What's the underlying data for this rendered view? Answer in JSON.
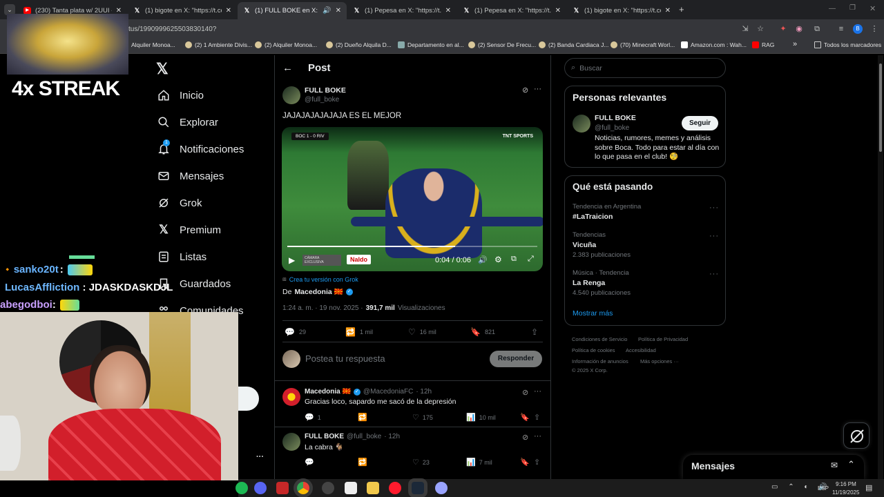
{
  "browser": {
    "tabs": [
      {
        "label": "(230) Tanta plata w/ 2UUI - You",
        "favicon": "youtube-icon",
        "active": false
      },
      {
        "label": "(1) bigote en X: \"https://t.co/or",
        "favicon": "x-icon",
        "active": false
      },
      {
        "label": "(1) FULL BOKE en X: \"JAJAJ",
        "favicon": "x-icon",
        "active": true
      },
      {
        "label": "(1) Pepesa en X: \"https://t.co/hz",
        "favicon": "x-icon",
        "active": false
      },
      {
        "label": "(1) Pepesa en X: \"https://t.co/jih",
        "favicon": "x-icon",
        "active": false
      },
      {
        "label": "(1) bigote en X: \"https://t.co/Qz",
        "favicon": "x-icon",
        "active": false
      }
    ],
    "url": "tus/1990999625503830140?",
    "bookmarks": [
      "Alquiler Monoa...",
      "(2) 1 Ambiente Divis...",
      "(2) Alquiler Monoa...",
      "(2) Dueño Alquila D...",
      "Departamento en al...",
      "(2) Sensor De Frecu...",
      "(2) Banda Cardiaca J...",
      "(70) Minecraft Worl...",
      "Amazon.com : Wah...",
      "RAG"
    ],
    "bookmarks_more": "»",
    "all_bookmarks": "Todos los marcadores"
  },
  "overlay": {
    "streak": "4x STREAK",
    "chat": [
      {
        "user": "sanko20t",
        "sep": " :",
        "msg": ""
      },
      {
        "user": "LucasAffliction",
        "sep": " :",
        "msg": "JDASKDASKDJL"
      },
      {
        "user": "abegodboi",
        "sep": " :",
        "msg": ""
      }
    ]
  },
  "nav": {
    "items": [
      {
        "label": "Inicio",
        "icon": "home-icon"
      },
      {
        "label": "Explorar",
        "icon": "search-icon"
      },
      {
        "label": "Notificaciones",
        "icon": "bell-icon",
        "badge": "1"
      },
      {
        "label": "Mensajes",
        "icon": "mail-icon"
      },
      {
        "label": "Grok",
        "icon": "grok-icon"
      },
      {
        "label": "Premium",
        "icon": "x-icon"
      },
      {
        "label": "Listas",
        "icon": "list-icon"
      },
      {
        "label": "Guardados",
        "icon": "bookmark-icon"
      },
      {
        "label": "Comunidades",
        "icon": "people-icon"
      }
    ],
    "more": "···"
  },
  "post": {
    "header": "Post",
    "author_name": "FULL BOKE",
    "author_handle": "@full_boke",
    "text": "JAJAJAJAJAJAJA ES EL MEJOR",
    "video": {
      "time": "0:04 / 0:06",
      "progress": 0.67,
      "scoreboard": "BOC 1 - 0 RIV",
      "broadcaster": "TNT SPORTS",
      "badge_left": "CÁMARA EXCLUSIVA",
      "badge_right": "Naldo"
    },
    "grok_link": "Crea tu versión con Grok",
    "from_prefix": "De",
    "from_account": "Macedonia 🇲🇰",
    "meta_time": "1:24 a. m. · 19 nov. 2025 ·",
    "views": "391,7 mil",
    "views_label": "Visualizaciones",
    "stats": {
      "replies": "29",
      "reposts": "1 mil",
      "likes": "16 mil",
      "bookmarks": "821"
    },
    "reply_placeholder": "Postea tu respuesta",
    "reply_button": "Responder"
  },
  "replies": [
    {
      "name": "Macedonia 🇲🇰",
      "handle": "@MacedoniaFC",
      "time": "· 12h",
      "text": "Gracias loco, sapardo me sacó de la depresión",
      "replies": "1",
      "likes": "175",
      "views": "10 mil"
    },
    {
      "name": "FULL BOKE",
      "handle": "@full_boke",
      "time": "· 12h",
      "text": "La cabra 🐐",
      "replies": "",
      "likes": "23",
      "views": "7 mil"
    }
  ],
  "right": {
    "search_placeholder": "Buscar",
    "relevant_title": "Personas relevantes",
    "relevant_name": "FULL BOKE",
    "relevant_handle": "@full_boke",
    "relevant_follow": "Seguir",
    "relevant_bio": "Noticias, rumores, memes y análisis sobre Boca. Todo para estar al día con lo que pasa en el club! 🧐",
    "trends_title": "Qué está pasando",
    "trends": [
      {
        "category": "Tendencia en Argentina",
        "name": "#LaTraicion",
        "count": ""
      },
      {
        "category": "Tendencias",
        "name": "Vicuña",
        "count": "2.383 publicaciones"
      },
      {
        "category": "Música · Tendencia",
        "name": "La Renga",
        "count": "4.540 publicaciones"
      }
    ],
    "show_more": "Mostrar más",
    "footer": [
      "Condiciones de Servicio",
      "Política de Privacidad",
      "Política de cookies",
      "Accesibilidad",
      "Información de anuncios",
      "Más opciones ···",
      "© 2025 X Corp."
    ],
    "messages_title": "Mensajes"
  },
  "taskbar": {
    "lang": "ESP",
    "time": "9:16 PM",
    "date": "11/19/2025"
  },
  "colors": {
    "accent": "#1d9bf0",
    "background": "#000000",
    "border": "#2f3336",
    "muted": "#71767b"
  }
}
